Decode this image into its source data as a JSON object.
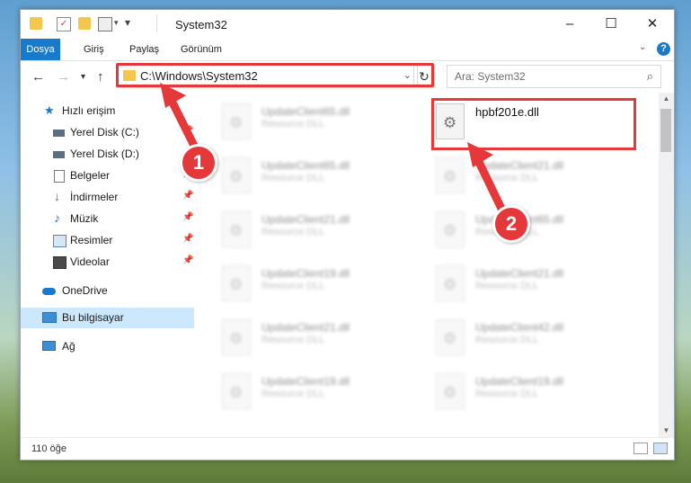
{
  "window": {
    "title": "System32"
  },
  "ribbon": {
    "tabs": [
      "Dosya",
      "Giriş",
      "Paylaş",
      "Görünüm"
    ],
    "help": "?"
  },
  "navbar": {
    "address": "C:\\Windows\\System32",
    "search_placeholder": "Ara: System32"
  },
  "navpane": {
    "items": [
      {
        "label": "Hızlı erişim",
        "icon": "star-icon",
        "pinned": false
      },
      {
        "label": "Yerel Disk (C:)",
        "icon": "drive-icon",
        "pinned": true
      },
      {
        "label": "Yerel Disk (D:)",
        "icon": "drive-icon",
        "pinned": false
      },
      {
        "label": "Belgeler",
        "icon": "documents-icon",
        "pinned": true
      },
      {
        "label": "İndirmeler",
        "icon": "download-icon",
        "pinned": true
      },
      {
        "label": "Müzik",
        "icon": "music-icon",
        "pinned": true
      },
      {
        "label": "Resimler",
        "icon": "pictures-icon",
        "pinned": true
      },
      {
        "label": "Videolar",
        "icon": "videos-icon",
        "pinned": true
      },
      {
        "label": "OneDrive",
        "icon": "cloud-icon",
        "pinned": false
      },
      {
        "label": "Bu bilgisayar",
        "icon": "computer-icon",
        "pinned": false,
        "selected": true
      },
      {
        "label": "Ağ",
        "icon": "network-icon",
        "pinned": false
      }
    ]
  },
  "files": [
    {
      "name": "UpdateClient65.dll",
      "type": "Resource DLL"
    },
    {
      "name": "hpbf201e.dll",
      "type": ""
    },
    {
      "name": "UpdateClient65.dll",
      "type": "Resource DLL"
    },
    {
      "name": "UpdateClient21.dll",
      "type": "Resource DLL"
    },
    {
      "name": "UpdateClient21.dll",
      "type": "Resource DLL"
    },
    {
      "name": "UpdateClient65.dll",
      "type": "Resource DLL"
    },
    {
      "name": "UpdateClient19.dll",
      "type": "Resource DLL"
    },
    {
      "name": "UpdateClient21.dll",
      "type": "Resource DLL"
    },
    {
      "name": "UpdateClient21.dll",
      "type": "Resource DLL"
    },
    {
      "name": "UpdateClient42.dll",
      "type": "Resource DLL"
    },
    {
      "name": "UpdateClient19.dll",
      "type": "Resource DLL"
    },
    {
      "name": "UpdateClient19.dll",
      "type": "Resource DLL"
    }
  ],
  "status": {
    "count": "110 öğe"
  },
  "annotations": {
    "step1": "1",
    "step2": "2",
    "color": "#e5383b"
  }
}
